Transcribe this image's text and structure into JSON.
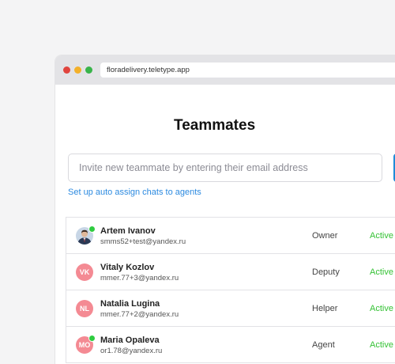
{
  "browser": {
    "url": "floradelivery.teletype.app"
  },
  "page": {
    "title": "Teammates",
    "invite_placeholder": "Invite new teammate by entering their email address",
    "auto_assign_link": "Set up auto assign chats to agents"
  },
  "members": [
    {
      "name": "Artem Ivanov",
      "email": "smms52+test@yandex.ru",
      "role": "Owner",
      "status": "Active",
      "initials": "",
      "avatar": "photo",
      "online": true
    },
    {
      "name": "Vitaly Kozlov",
      "email": "mmer.77+3@yandex.ru",
      "role": "Deputy",
      "status": "Active",
      "initials": "VK",
      "avatar": "initials",
      "online": false
    },
    {
      "name": "Natalia Lugina",
      "email": "mmer.77+2@yandex.ru",
      "role": "Helper",
      "status": "Active",
      "initials": "NL",
      "avatar": "initials",
      "online": false
    },
    {
      "name": "Maria Opaleva",
      "email": "or1.78@yandex.ru",
      "role": "Agent",
      "status": "Active",
      "initials": "MO",
      "avatar": "initials",
      "online": true
    }
  ],
  "colors": {
    "status_active": "#35c235",
    "avatar_bg": "#f48a93",
    "link": "#2c8ae0",
    "online_dot": "#2ecc40"
  }
}
